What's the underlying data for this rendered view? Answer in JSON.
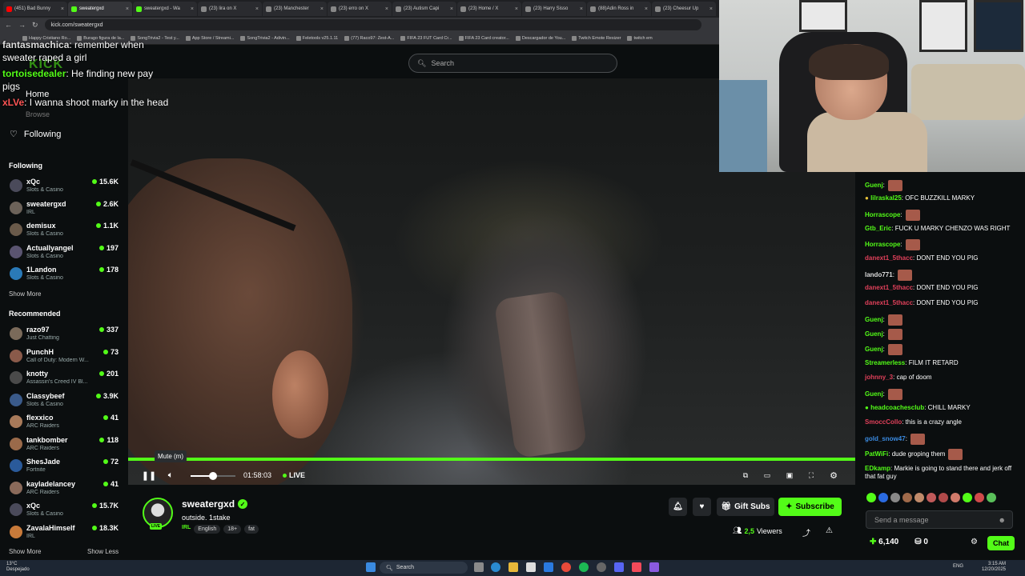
{
  "browser": {
    "tabs": [
      {
        "title": "(451) Bad Bunny",
        "color": "#ff0000"
      },
      {
        "title": "sweatergxd",
        "color": "#53fc18",
        "active": true
      },
      {
        "title": "sweatergxd - Wa",
        "color": "#53fc18"
      },
      {
        "title": "(23) lira on X",
        "color": "#888888"
      },
      {
        "title": "(23) Manchester",
        "color": "#888888"
      },
      {
        "title": "(23) erro on X",
        "color": "#888888"
      },
      {
        "title": "(23) Autism Capi",
        "color": "#888888"
      },
      {
        "title": "(23) Home / X",
        "color": "#888888"
      },
      {
        "title": "(23) Harry Sisso",
        "color": "#888888"
      },
      {
        "title": "(88)Adin Ross in",
        "color": "#888888"
      },
      {
        "title": "(23) Cheesur Up",
        "color": "#888888"
      }
    ],
    "url": "kick.com/sweatergxd",
    "bookmarks": [
      "Happy Cristiano Ro...",
      "Burago figura de la...",
      "SongTrivia2 - Test y...",
      "App Store / Streami...",
      "SongTrivia2 - Adivin...",
      "Feletools v25.1.11",
      "(77) Raco97: Zest-A...",
      "FIFA 23 FUT Card Cr...",
      "FIFA 23 Card creator...",
      "Descargador de You...",
      "Twitch Emote Resizer",
      "twitch em"
    ]
  },
  "kick": {
    "logo": "KICK",
    "search_placeholder": "Search",
    "nav": {
      "home": "Home",
      "browse": "Browse",
      "following": "Following"
    }
  },
  "overlay_chat": [
    {
      "user": "fantasmachica",
      "text": ": remember when sweater raped a girl",
      "color": "#dddddd"
    },
    {
      "user": "tortoisedealer",
      "text": ": He finding new pay pigs",
      "color": "#53fc18"
    },
    {
      "user": "xLVe",
      "text": ": I wanna shoot marky in the head",
      "color": "#ff5555"
    }
  ],
  "sidebar": {
    "following_header": "Following",
    "following": [
      {
        "name": "xQc",
        "category": "Slots & Casino",
        "viewers": "15.6K",
        "avatar": "#4a4a5a"
      },
      {
        "name": "sweatergxd",
        "category": "IRL",
        "viewers": "2.6K",
        "avatar": "#6c6259"
      },
      {
        "name": "demisux",
        "category": "Slots & Casino",
        "viewers": "1.1K",
        "avatar": "#6a5a4a"
      },
      {
        "name": "Actuallyangel",
        "category": "Slots & Casino",
        "viewers": "197",
        "avatar": "#5a5470"
      },
      {
        "name": "1Landon",
        "category": "Slots & Casino",
        "viewers": "178",
        "avatar": "#2a7ab8"
      }
    ],
    "show_more_1": "Show More",
    "recommended_header": "Recommended",
    "recommended": [
      {
        "name": "razo97",
        "category": "Just Chatting",
        "viewers": "337",
        "avatar": "#7a6a5a"
      },
      {
        "name": "PunchH",
        "category": "Call of Duty: Modern W...",
        "viewers": "73",
        "avatar": "#8a5a4a"
      },
      {
        "name": "knotty",
        "category": "Assassin's Creed IV Bl...",
        "viewers": "201",
        "avatar": "#4a4a4a"
      },
      {
        "name": "Classybeef",
        "category": "Slots & Casino",
        "viewers": "3.9K",
        "avatar": "#3a5a8a"
      },
      {
        "name": "flexxico",
        "category": "ARC Raiders",
        "viewers": "41",
        "avatar": "#a87a5a"
      },
      {
        "name": "tankbomber",
        "category": "ARC Raiders",
        "viewers": "118",
        "avatar": "#9a6a4a"
      },
      {
        "name": "ShesJade",
        "category": "Fortnite",
        "viewers": "72",
        "avatar": "#2a5a9a"
      },
      {
        "name": "kayladelancey",
        "category": "ARC Raiders",
        "viewers": "41",
        "avatar": "#8a6a5a"
      },
      {
        "name": "xQc",
        "category": "Slots & Casino",
        "viewers": "15.7K",
        "avatar": "#4a4a5a"
      },
      {
        "name": "ZavalaHimself",
        "category": "IRL",
        "viewers": "18.3K",
        "avatar": "#c87a3a"
      }
    ],
    "show_more_2": "Show More",
    "show_less": "Show Less"
  },
  "player": {
    "tooltip": "Mute (m)",
    "time": "01:58:03",
    "live": "LIVE",
    "volume_fraction": 0.75,
    "progress_fraction": 1.0
  },
  "stream": {
    "name": "sweatergxd",
    "title": "outside. 1stake",
    "category": "IRL",
    "tags": [
      "English",
      "18+",
      "fat"
    ],
    "live_badge": "LIVE",
    "gift_label": "Gift Subs",
    "subscribe_label": "Subscribe",
    "viewers_count": "2,5",
    "viewers_label": "Viewers"
  },
  "chat": {
    "messages": [
      {
        "user": "Guenj",
        "text": ":",
        "color": "#53fc18",
        "emote": true
      },
      {
        "user": "lilraskal25",
        "text": ": OFC BUZZKILL MARKY",
        "color": "#53fc18",
        "badge": "#e8c33a"
      },
      {
        "user": "Horrascope",
        "text": ":",
        "color": "#53fc18",
        "emote": true
      },
      {
        "user": "Gtb_Eric",
        "text": ": FUCK U MARKY CHENZO WAS RIGHT",
        "color": "#53fc18"
      },
      {
        "user": "Horrascope",
        "text": ":",
        "color": "#53fc18",
        "emote": true
      },
      {
        "user": "danext1_5thacc",
        "text": ": DONT END YOU PIG",
        "color": "#e0405a"
      },
      {
        "user": "lando771",
        "text": ":",
        "color": "#dddddd",
        "emote": true
      },
      {
        "user": "danext1_5thacc",
        "text": ": DONT END YOU PIG",
        "color": "#e0405a"
      },
      {
        "user": "danext1_5thacc",
        "text": ": DONT END YOU PIG",
        "color": "#e0405a"
      },
      {
        "user": "Guenj",
        "text": ":",
        "color": "#53fc18",
        "emote": true
      },
      {
        "user": "Guenj",
        "text": ":",
        "color": "#53fc18",
        "emote": true
      },
      {
        "user": "Guenj",
        "text": ":",
        "color": "#53fc18",
        "emote": true
      },
      {
        "user": "Streamerless",
        "text": ": FILM IT RETARD",
        "color": "#53fc18"
      },
      {
        "user": "johnny_3",
        "text": ": cap of doom",
        "color": "#e0405a"
      },
      {
        "user": "Guenj",
        "text": ":",
        "color": "#53fc18",
        "emote": true
      },
      {
        "user": "headcoachesclub",
        "text": ": CHILL MARKY",
        "color": "#53fc18",
        "badge": "#53fc18"
      },
      {
        "user": "SmoccCollo",
        "text": ": this is a crazy angle",
        "color": "#e0405a"
      },
      {
        "user": "gold_snow47",
        "text": ":",
        "color": "#3a8ae0",
        "emote": true
      },
      {
        "user": "PatWiFi",
        "text": ": dude groping them",
        "color": "#53fc18",
        "emote": true
      },
      {
        "user": "EDkamp",
        "text": ": Markie is going to stand there and jerk off that fat guy",
        "color": "#53fc18"
      }
    ],
    "input_placeholder": "Send a message",
    "points": "6,140",
    "rewards": "0",
    "chat_button": "Chat"
  },
  "taskbar": {
    "weather_temp": "13°C",
    "weather_desc": "Despejado",
    "search": "Search",
    "lang": "ENG",
    "time": "3:15 AM",
    "date": "12/20/2025"
  }
}
